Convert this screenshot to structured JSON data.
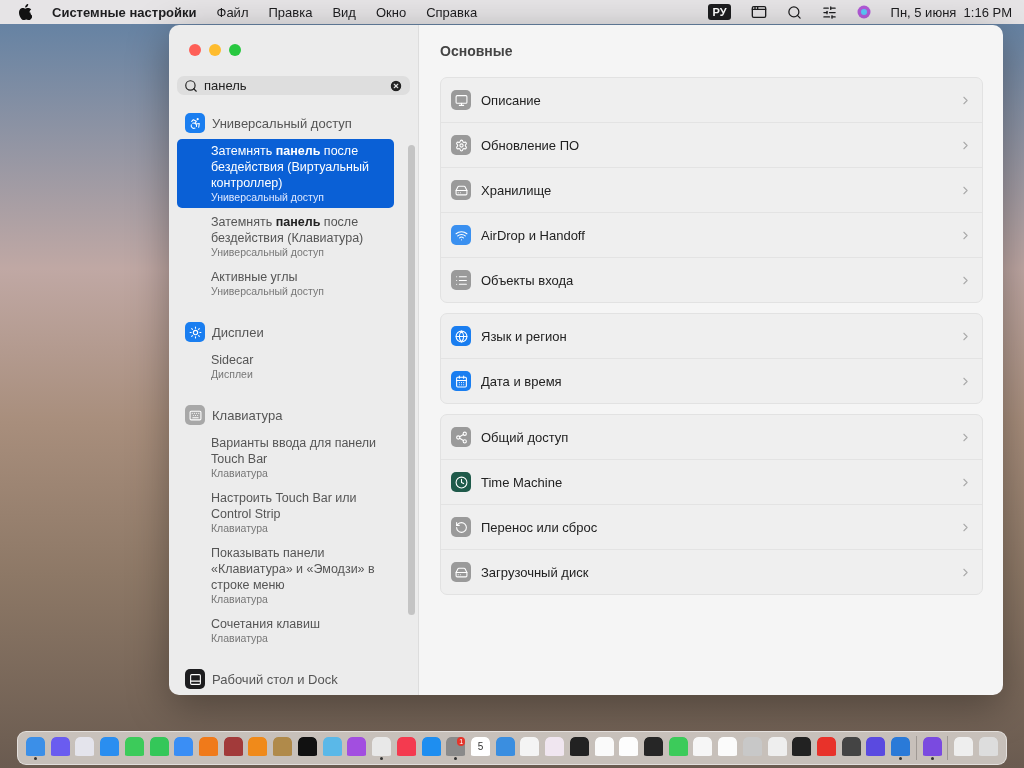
{
  "menu_bar": {
    "app_name": "Системные настройки",
    "menus": [
      "Файл",
      "Правка",
      "Вид",
      "Окно",
      "Справка"
    ],
    "input_source": "РУ",
    "clock": "Пн, 5 июня  1:16 PM"
  },
  "window": {
    "title": "Основные"
  },
  "search": {
    "value": "панель"
  },
  "results": [
    {
      "title": "Универсальный доступ",
      "items": [
        {
          "title": "Затемнять **панель** после бездействия (Виртуальный контроллер)",
          "subtitle": "Универсальный доступ",
          "selected": true
        },
        {
          "title": "Затемнять **панель** после бездействия (Клавиатура)",
          "subtitle": "Универсальный доступ",
          "selected": false
        },
        {
          "title": "Активные углы",
          "subtitle": "Универсальный доступ",
          "selected": false
        }
      ]
    },
    {
      "title": "Дисплеи",
      "items": [
        {
          "title": "Sidecar",
          "subtitle": "Дисплеи",
          "selected": false
        }
      ]
    },
    {
      "title": "Клавиатура",
      "items": [
        {
          "title": "Варианты ввода для панели Touch Bar",
          "subtitle": "Клавиатура",
          "selected": false
        },
        {
          "title": "Настроить Touch Bar или Control Strip",
          "subtitle": "Клавиатура",
          "selected": false
        },
        {
          "title": "Показывать панели «Клавиатура» и «Эмодзи» в строке меню",
          "subtitle": "Клавиатура",
          "selected": false
        },
        {
          "title": "Сочетания клавиш",
          "subtitle": "Клавиатура",
          "selected": false
        }
      ]
    },
    {
      "title": "Рабочий стол и Dock"
    }
  ],
  "sections": [
    [
      {
        "label": "Описание"
      },
      {
        "label": "Обновление ПО"
      },
      {
        "label": "Хранилище"
      },
      {
        "label": "AirDrop и Handoff"
      },
      {
        "label": "Объекты входа"
      }
    ],
    [
      {
        "label": "Язык и регион"
      },
      {
        "label": "Дата и время"
      }
    ],
    [
      {
        "label": "Общий доступ"
      },
      {
        "label": "Time Machine"
      },
      {
        "label": "Перенос или сброс"
      },
      {
        "label": "Загрузочный диск"
      }
    ]
  ],
  "dock": [
    {
      "kind": "app",
      "color": "#3b8fe8",
      "running": true
    },
    {
      "kind": "app",
      "color": "#6a5cf0",
      "running": false
    },
    {
      "kind": "app",
      "color": "#e4e4ec",
      "running": false
    },
    {
      "kind": "app",
      "color": "#2a8ef0",
      "running": false
    },
    {
      "kind": "app",
      "color": "#3ccb5a",
      "running": false
    },
    {
      "kind": "app",
      "color": "#34c759",
      "running": false
    },
    {
      "kind": "app",
      "color": "#3a8ef5",
      "running": false
    },
    {
      "kind": "app",
      "color": "#f07a1a",
      "running": false
    },
    {
      "kind": "app",
      "color": "#a23a3a",
      "running": false
    },
    {
      "kind": "app",
      "color": "#f08a1a",
      "running": false
    },
    {
      "kind": "app",
      "color": "#b08a4a",
      "running": false
    },
    {
      "kind": "app",
      "color": "#111111",
      "running": false
    },
    {
      "kind": "app",
      "color": "#5ab8e8",
      "running": false
    },
    {
      "kind": "app",
      "color": "#a24ee0",
      "running": false
    },
    {
      "kind": "app",
      "color": "#e8e8e8",
      "running": true
    },
    {
      "kind": "app",
      "color": "#f43a4f",
      "running": false
    },
    {
      "kind": "app",
      "color": "#1e8ef0",
      "running": false
    },
    {
      "kind": "app",
      "color": "#8a8a8a",
      "running": true,
      "badge": "1"
    },
    {
      "kind": "calendar",
      "color": "#ffffff",
      "running": false,
      "day": "5"
    },
    {
      "kind": "app",
      "color": "#3a8ee0",
      "running": false
    },
    {
      "kind": "app",
      "color": "#f4f4f4",
      "running": false
    },
    {
      "kind": "app",
      "color": "#f0e6f0",
      "running": false
    },
    {
      "kind": "app",
      "color": "#222222",
      "running": false
    },
    {
      "kind": "app",
      "color": "#fafafa",
      "running": false
    },
    {
      "kind": "app",
      "color": "#fdfdfd",
      "running": false
    },
    {
      "kind": "app",
      "color": "#262626",
      "running": false
    },
    {
      "kind": "app",
      "color": "#3ccb5a",
      "running": false
    },
    {
      "kind": "app",
      "color": "#f6f6f6",
      "running": false
    },
    {
      "kind": "app",
      "color": "#fbfbfb",
      "running": false
    },
    {
      "kind": "app",
      "color": "#c8c8c8",
      "running": false
    },
    {
      "kind": "app",
      "color": "#eeeeee",
      "running": false
    },
    {
      "kind": "app",
      "color": "#222222",
      "running": false
    },
    {
      "kind": "app",
      "color": "#e8322a",
      "running": false
    },
    {
      "kind": "app",
      "color": "#444444",
      "running": false
    },
    {
      "kind": "app",
      "color": "#5a4ae0",
      "running": false
    },
    {
      "kind": "app",
      "color": "#2a7ad8",
      "running": true
    },
    {
      "kind": "separator"
    },
    {
      "kind": "app",
      "color": "#7a4ae0",
      "running": true
    },
    {
      "kind": "separator"
    },
    {
      "kind": "app",
      "color": "#eeeeee",
      "running": false
    },
    {
      "kind": "app",
      "color": "#dddddd",
      "running": false
    }
  ]
}
